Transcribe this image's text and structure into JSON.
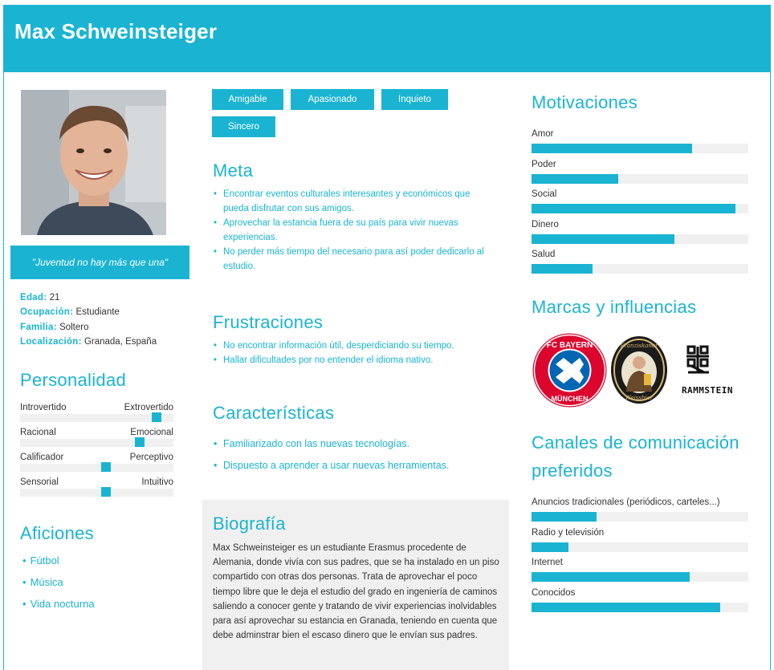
{
  "header": {
    "name": "Max Schweinsteiger"
  },
  "profile": {
    "quote": "\"Juventud no hay más que una\"",
    "info": [
      {
        "label": "Edad:",
        "value": "21"
      },
      {
        "label": "Ocupación:",
        "value": "Estudiante"
      },
      {
        "label": "Familia:",
        "value": "Soltero"
      },
      {
        "label": "Localización:",
        "value": "Granada, España"
      }
    ]
  },
  "personality": {
    "title": "Personalidad",
    "traits": [
      {
        "left": "Introvertido",
        "right": "Extrovertido",
        "level": 0.89
      },
      {
        "left": "Racional",
        "right": "Emocional",
        "level": 0.78
      },
      {
        "left": "Calificador",
        "right": "Perceptivo",
        "level": 0.56
      },
      {
        "left": "Sensorial",
        "right": "Intuitivo",
        "level": 0.56
      }
    ]
  },
  "hobbies": {
    "title": "Aficiones",
    "items": [
      "Fútbol",
      "Música",
      "Vida nocturna"
    ]
  },
  "tags": [
    "Amigable",
    "Apasionado",
    "Inquieto",
    "Sincero"
  ],
  "goals": {
    "title": "Meta",
    "items": [
      "Encontrar eventos culturales interesantes y económicos que pueda disfrutar con sus amigos.",
      "Aprovechar la estancia fuera de su país para vivir nuevas experiencias.",
      "No perder más tiempo del necesario para así poder dedicarlo al estudio."
    ]
  },
  "frustrations": {
    "title": "Frustraciones",
    "items": [
      "No encontrar información útil, desperdiciando su tiempo.",
      "Hallar dificultades por no entender el idioma nativo."
    ]
  },
  "characteristics": {
    "title": "Características",
    "items": [
      "Familiarizado con las nuevas tecnologías.",
      "Dispuesto a aprender a usar nuevas herramientas."
    ]
  },
  "biography": {
    "title": "Biografía",
    "text": "Max Schweinsteiger es un estudiante Erasmus procedente de Alemania, donde vivía con sus padres, que se ha instalado en un piso compartido con otras dos personas. Trata de aprovechar el poco tiempo libre que le deja el estudio del grado en ingeniería de caminos saliendo a conocer gente y tratando de vivir experiencias inolvidables para así aprovechar su estancia en Granada, teniendo en cuenta que debe adminstrar bien el escaso dinero que le envían sus padres."
  },
  "motivations": {
    "title": "Motivaciones",
    "items": [
      {
        "label": "Amor",
        "level": 0.74
      },
      {
        "label": "Poder",
        "level": 0.4
      },
      {
        "label": "Social",
        "level": 0.94
      },
      {
        "label": "Dinero",
        "level": 0.66
      },
      {
        "label": "Salud",
        "level": 0.28
      }
    ]
  },
  "brands": {
    "title": "Marcas y influencias",
    "logos": [
      {
        "icon": "fc-bayern-logo",
        "text_top": "FC BAYERN",
        "text_bottom": "MÜNCHEN"
      },
      {
        "icon": "franziskaner-logo",
        "text_top": "Franziskaner",
        "text_bottom": "Weissbier"
      },
      {
        "icon": "rammstein-logo",
        "text": "RAMMSTEIN"
      }
    ]
  },
  "channels": {
    "title": "Canales de comunicación preferidos",
    "title_line1": "Canales de comunicación",
    "title_line2": "preferidos",
    "items": [
      {
        "label": "Anuncios tradicionales (periódicos, carteles...)",
        "level": 0.3
      },
      {
        "label": "Radio y televisión",
        "level": 0.17
      },
      {
        "label": "Internet",
        "level": 0.73
      },
      {
        "label": "Conocidos",
        "level": 0.87
      }
    ]
  },
  "colors": {
    "accent": "#1ab4d2",
    "track": "#f0f0f0"
  }
}
